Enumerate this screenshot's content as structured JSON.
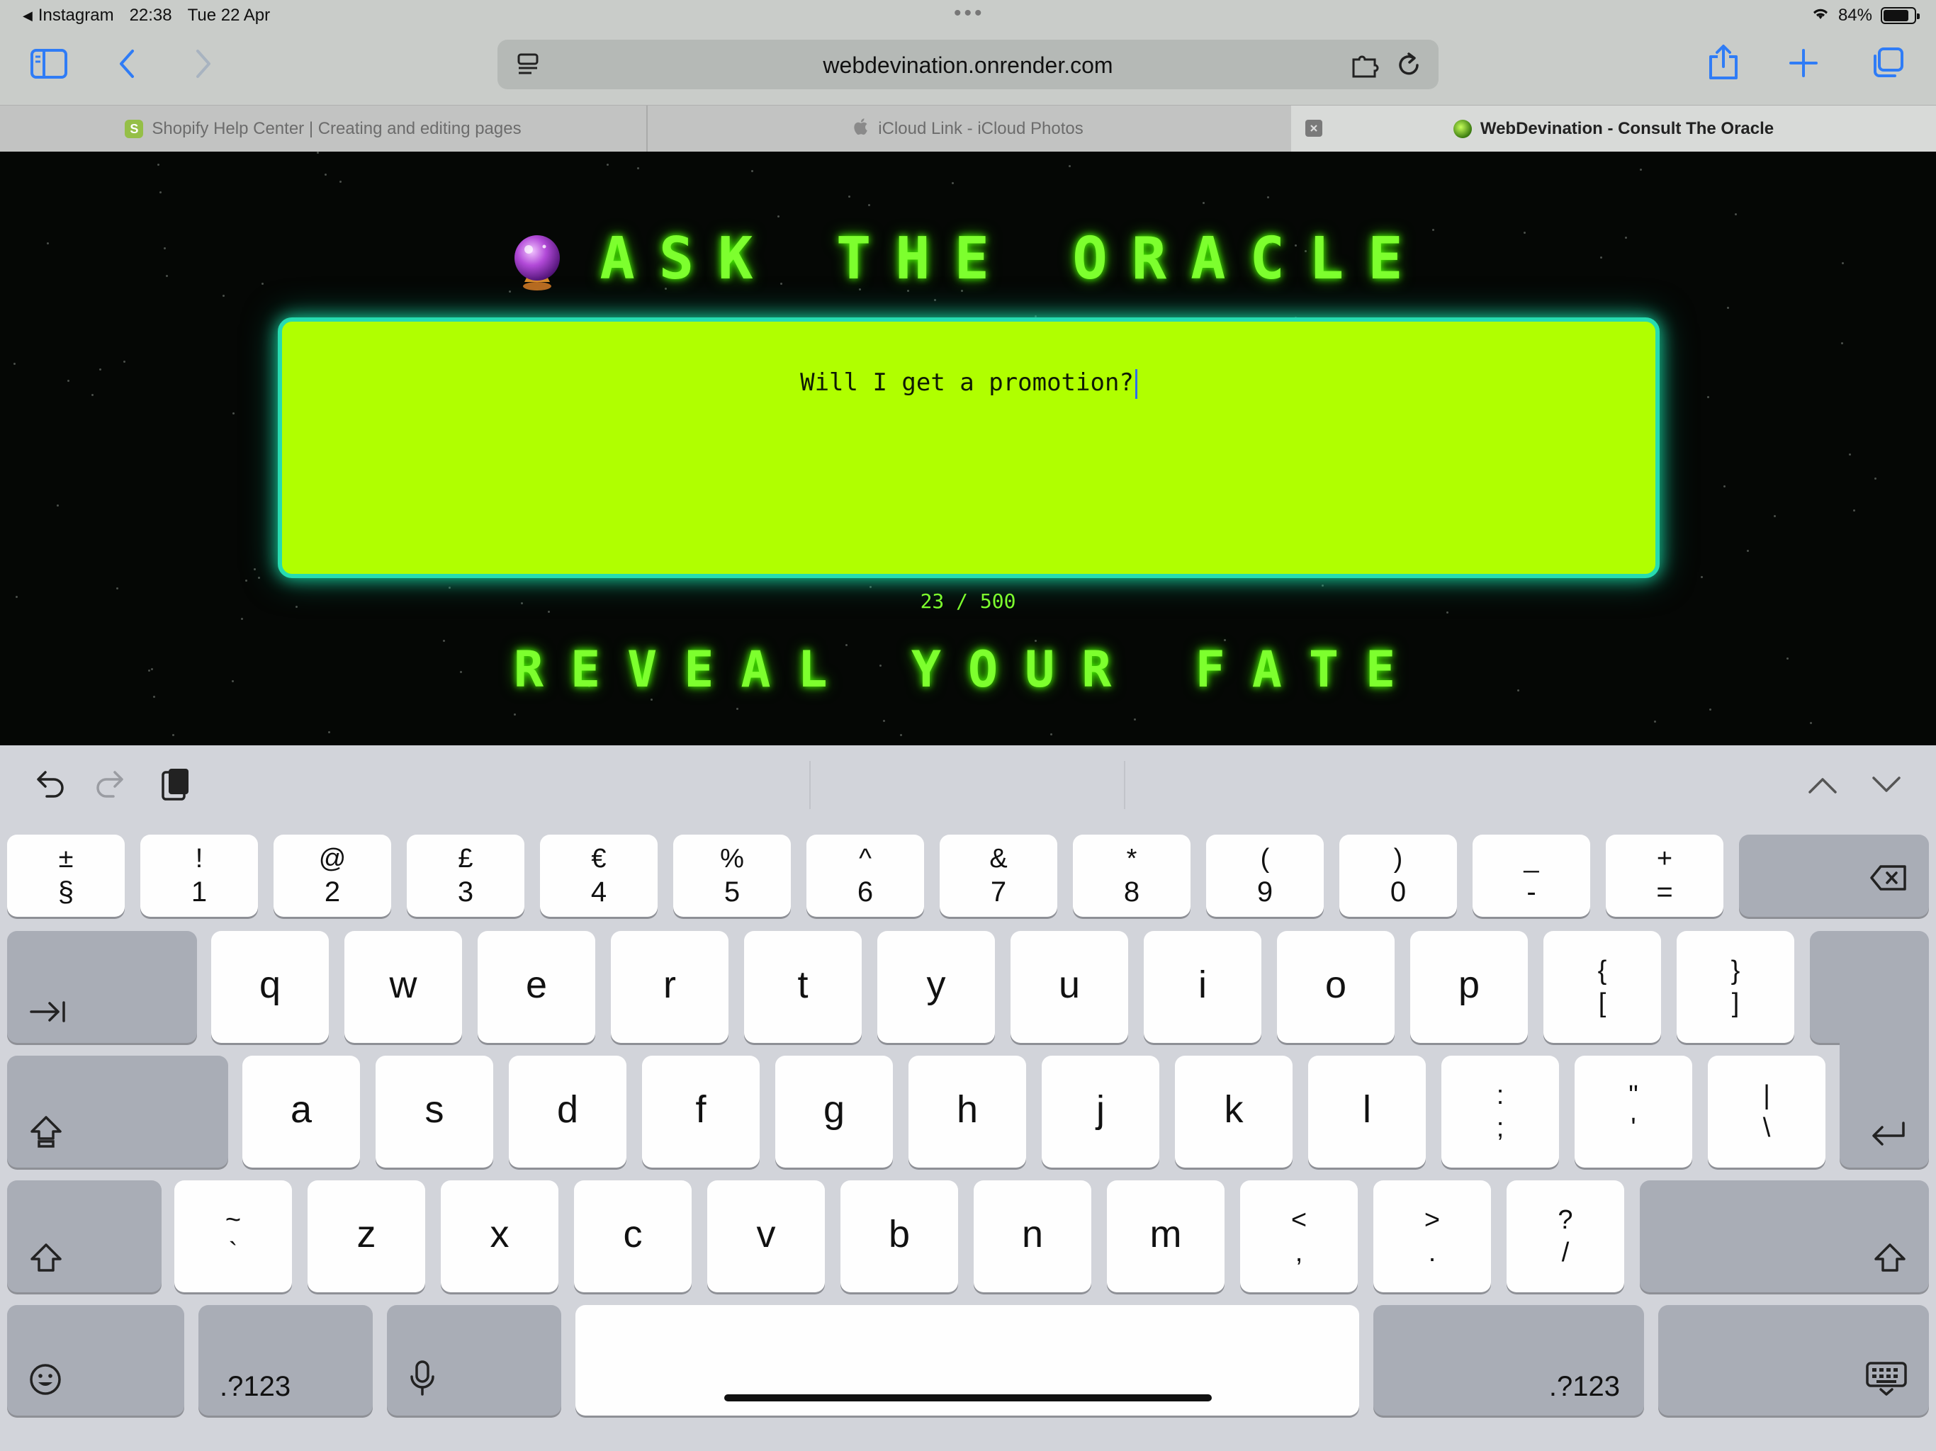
{
  "status_bar": {
    "back_app": "Instagram",
    "time": "22:38",
    "date": "Tue 22 Apr",
    "battery": "84%",
    "battery_level": 0.84
  },
  "browser": {
    "url": "webdevination.onrender.com",
    "tabs": [
      {
        "title": "Shopify Help Center | Creating and editing pages",
        "favicon": "shopify-icon",
        "active": false
      },
      {
        "title": "iCloud Link - iCloud Photos",
        "favicon": "apple-icon",
        "active": false
      },
      {
        "title": "WebDevination - Consult The Oracle",
        "favicon": "oracle-icon",
        "active": true
      }
    ]
  },
  "page": {
    "title": "ASK THE ORACLE",
    "title_icon": "crystal-ball-icon",
    "question": "Will I get a promotion?",
    "char_count": "23 / 500",
    "reveal_label": "REVEAL YOUR FATE",
    "colors": {
      "neon_green": "#7dff2e",
      "box_fill": "#b0ff00",
      "box_border": "#27dbb0",
      "background": "#050705"
    }
  },
  "keyboard": {
    "number_row": [
      {
        "top": "±",
        "bot": "§"
      },
      {
        "top": "!",
        "bot": "1"
      },
      {
        "top": "@",
        "bot": "2"
      },
      {
        "top": "£",
        "bot": "3"
      },
      {
        "top": "€",
        "bot": "4"
      },
      {
        "top": "%",
        "bot": "5"
      },
      {
        "top": "^",
        "bot": "6"
      },
      {
        "top": "&",
        "bot": "7"
      },
      {
        "top": "*",
        "bot": "8"
      },
      {
        "top": "(",
        "bot": "9"
      },
      {
        "top": ")",
        "bot": "0"
      },
      {
        "top": "_",
        "bot": "-"
      },
      {
        "top": "+",
        "bot": "="
      }
    ],
    "row_q": [
      "q",
      "w",
      "e",
      "r",
      "t",
      "y",
      "u",
      "i",
      "o",
      "p"
    ],
    "row_q_extra": [
      {
        "top": "{",
        "bot": "["
      },
      {
        "top": "}",
        "bot": "]"
      }
    ],
    "row_a": [
      "a",
      "s",
      "d",
      "f",
      "g",
      "h",
      "j",
      "k",
      "l"
    ],
    "row_a_extra": [
      {
        "top": ":",
        "bot": ";"
      },
      {
        "top": "\"",
        "bot": "'"
      },
      {
        "top": "|",
        "bot": "\\"
      }
    ],
    "row_z_first": {
      "top": "~",
      "bot": "`"
    },
    "row_z": [
      "z",
      "x",
      "c",
      "v",
      "b",
      "n",
      "m"
    ],
    "row_z_extra": [
      {
        "top": "<",
        "bot": ","
      },
      {
        "top": ">",
        "bot": "."
      },
      {
        "top": "?",
        "bot": "/"
      }
    ],
    "numbers_label_left": ".?123",
    "numbers_label_right": ".?123"
  }
}
